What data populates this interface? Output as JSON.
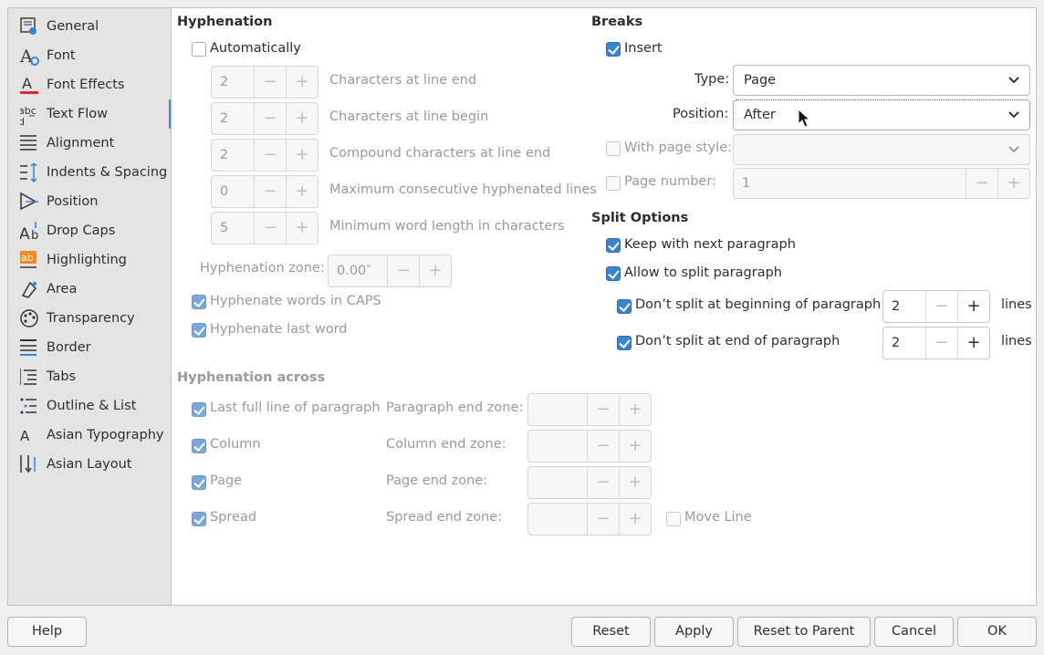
{
  "sidebar": {
    "selected_index": 3,
    "items": [
      {
        "label": "General",
        "icon": "general-icon"
      },
      {
        "label": "Font",
        "icon": "font-icon"
      },
      {
        "label": "Font Effects",
        "icon": "font-effects-icon"
      },
      {
        "label": "Text Flow",
        "icon": "text-flow-icon"
      },
      {
        "label": "Alignment",
        "icon": "alignment-icon"
      },
      {
        "label": "Indents & Spacing",
        "icon": "indents-spacing-icon"
      },
      {
        "label": "Position",
        "icon": "position-icon"
      },
      {
        "label": "Drop Caps",
        "icon": "drop-caps-icon"
      },
      {
        "label": "Highlighting",
        "icon": "highlighting-icon"
      },
      {
        "label": "Area",
        "icon": "area-icon"
      },
      {
        "label": "Transparency",
        "icon": "transparency-icon"
      },
      {
        "label": "Border",
        "icon": "border-icon"
      },
      {
        "label": "Tabs",
        "icon": "tabs-icon"
      },
      {
        "label": "Outline & List",
        "icon": "outline-list-icon"
      },
      {
        "label": "Asian Typography",
        "icon": "asian-typography-icon"
      },
      {
        "label": "Asian Layout",
        "icon": "asian-layout-icon"
      }
    ]
  },
  "hyphenation": {
    "title": "Hyphenation",
    "automatically": {
      "label": "Automatically",
      "checked": false
    },
    "rows": [
      {
        "value": "2",
        "label": "Characters at line end"
      },
      {
        "value": "2",
        "label": "Characters at line begin"
      },
      {
        "value": "2",
        "label": "Compound characters at line end"
      },
      {
        "value": "0",
        "label": "Maximum consecutive hyphenated lines"
      },
      {
        "value": "5",
        "label": "Minimum word length in characters"
      }
    ],
    "zone": {
      "label": "Hyphenation zone:",
      "value": "0.00″"
    },
    "caps": {
      "label": "Hyphenate words in CAPS",
      "checked": true
    },
    "last_word": {
      "label": "Hyphenate last word",
      "checked": true
    }
  },
  "across": {
    "title": "Hyphenation across",
    "rows": [
      {
        "check_label": "Last full line of paragraph",
        "zone_label": "Paragraph end zone:",
        "value": ""
      },
      {
        "check_label": "Column",
        "zone_label": "Column end zone:",
        "value": ""
      },
      {
        "check_label": "Page",
        "zone_label": "Page end zone:",
        "value": ""
      },
      {
        "check_label": "Spread",
        "zone_label": "Spread end zone:",
        "value": ""
      }
    ],
    "move_line": {
      "label": "Move Line",
      "checked": false
    }
  },
  "breaks": {
    "title": "Breaks",
    "insert": {
      "label": "Insert",
      "checked": true
    },
    "type": {
      "label": "Type:",
      "value": "Page"
    },
    "position": {
      "label": "Position:",
      "value": "After"
    },
    "page_style": {
      "label": "With page style:",
      "value": "",
      "checked": false
    },
    "page_number": {
      "label": "Page number:",
      "value": "1",
      "checked": false
    }
  },
  "split": {
    "title": "Split Options",
    "keep_next": {
      "label": "Keep with next paragraph",
      "checked": true
    },
    "allow_split": {
      "label": "Allow to split paragraph",
      "checked": true
    },
    "begin": {
      "label": "Don’t split at beginning of paragraph",
      "value": "2",
      "unit": "lines",
      "checked": true
    },
    "end": {
      "label": "Don’t split at end of paragraph",
      "value": "2",
      "unit": "lines",
      "checked": true
    }
  },
  "buttons": {
    "help": "Help",
    "reset": "Reset",
    "apply": "Apply",
    "reset_parent": "Reset to Parent",
    "cancel": "Cancel",
    "ok": "OK"
  },
  "colors": {
    "accent": "#3a84cf",
    "selection_bar": "#3d8bd8",
    "font_effects_red": "#e0262f",
    "highlight_orange": "#f28a1e"
  }
}
